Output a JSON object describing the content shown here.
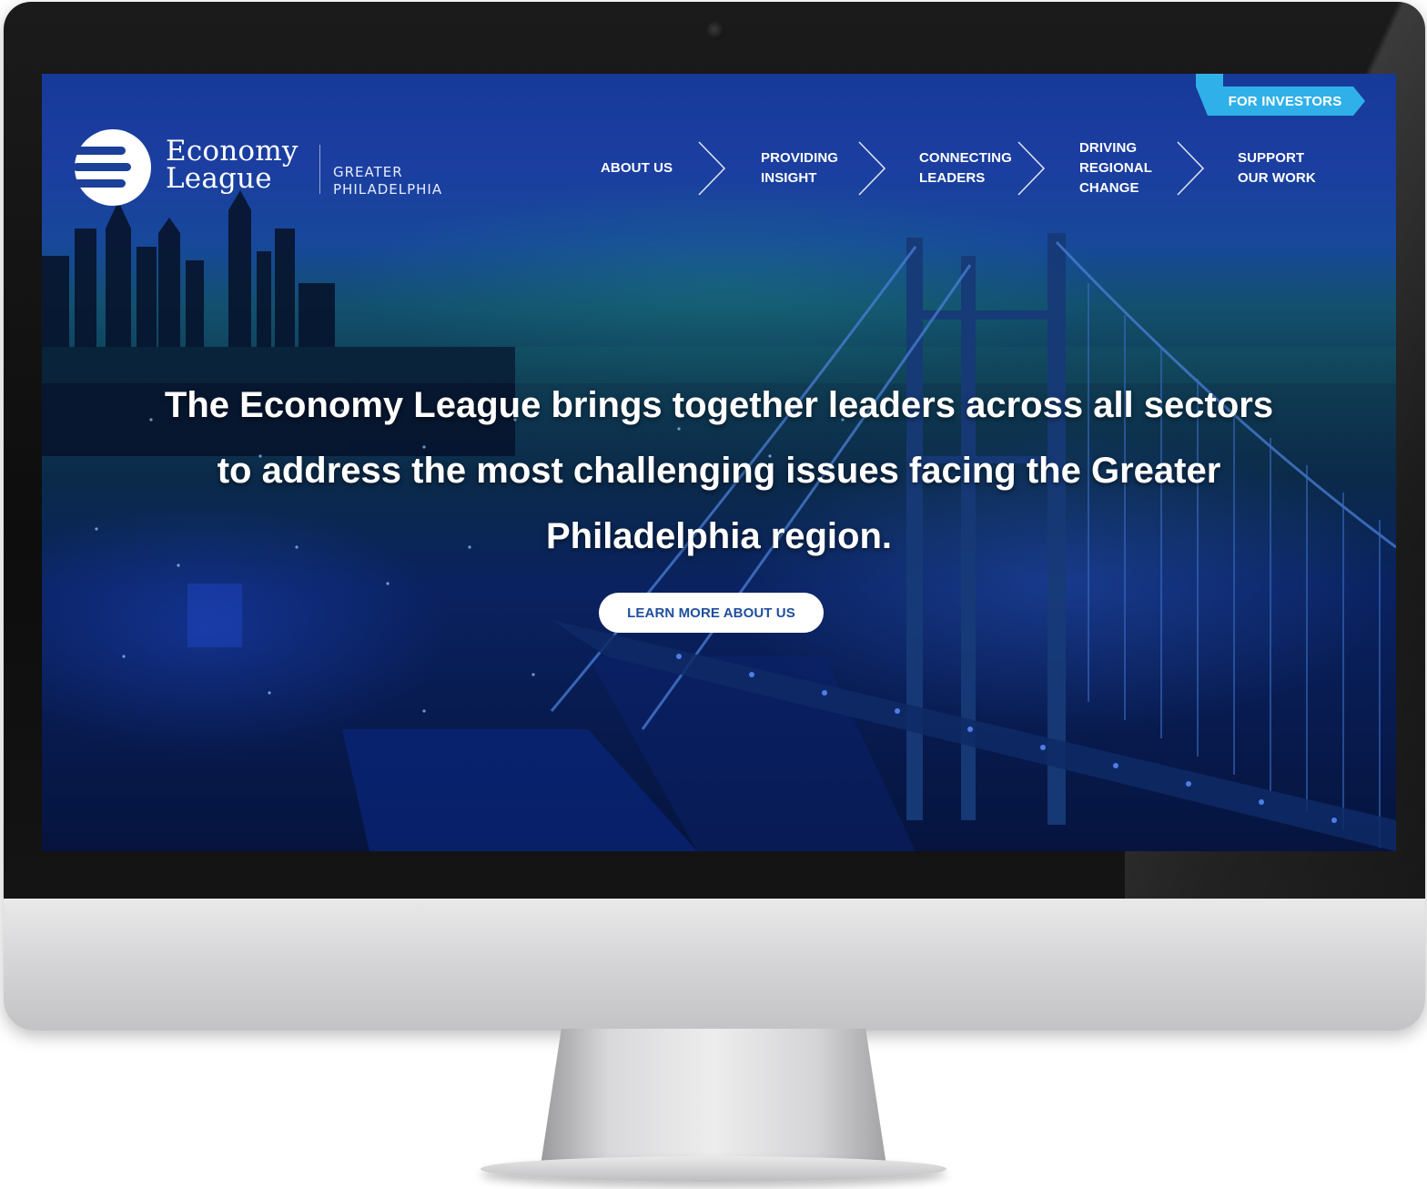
{
  "brand": {
    "line1": "Economy",
    "line2": "League",
    "region1": "GREATER",
    "region2": "PHILADELPHIA"
  },
  "utility_link": "FOR INVESTORS",
  "nav": [
    {
      "label": "ABOUT US"
    },
    {
      "label": "PROVIDING\nINSIGHT"
    },
    {
      "label": "CONNECTING\nLEADERS"
    },
    {
      "label": "DRIVING\nREGIONAL\nCHANGE"
    },
    {
      "label": "SUPPORT\nOUR WORK"
    }
  ],
  "hero": {
    "line1": "The Economy League brings together leaders across all sectors",
    "line2": "to address the most challenging issues facing the Greater",
    "line3": "Philadelphia region.",
    "cta_label": "LEARN MORE ABOUT US"
  },
  "colors": {
    "accent": "#2fb0e8",
    "cta_text": "#1f4f9c",
    "hero_top": "#163a9a",
    "hero_bottom": "#06143e"
  }
}
